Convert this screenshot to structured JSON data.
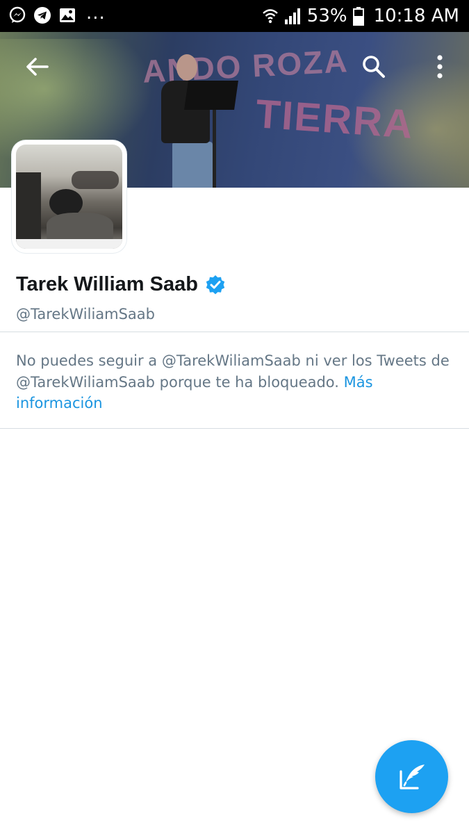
{
  "status_bar": {
    "left_icons": [
      "messenger-icon",
      "telegram-icon",
      "gallery-icon"
    ],
    "overflow": "...",
    "battery_percent": "53%",
    "time": "10:18 AM"
  },
  "toolbar": {
    "back_icon": "arrow-left-icon",
    "search_icon": "search-icon",
    "menu_icon": "more-vertical-icon"
  },
  "banner": {
    "line1": "ANDO ROZA",
    "line2": "TIERRA"
  },
  "profile": {
    "name": "Tarek William Saab",
    "verified": true,
    "handle": "@TarekWiliamSaab"
  },
  "blocked": {
    "message": "No puedes seguir a @TarekWiliamSaab ni ver los Tweets de @TarekWiliamSaab porque te ha bloqueado. ",
    "link_text": "Más información"
  },
  "fab": {
    "icon": "compose-tweet-icon"
  },
  "colors": {
    "accent": "#1da1f2",
    "link": "#1b95e0",
    "secondary_text": "#657786"
  }
}
